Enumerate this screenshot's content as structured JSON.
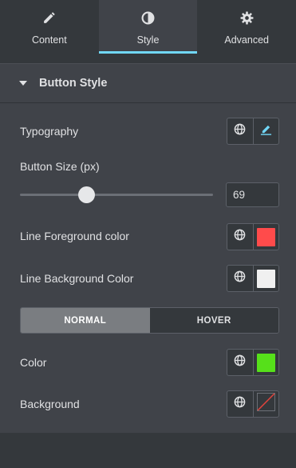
{
  "tabs": [
    {
      "label": "Content",
      "icon": "pencil-icon"
    },
    {
      "label": "Style",
      "icon": "half-circle-icon"
    },
    {
      "label": "Advanced",
      "icon": "gear-icon"
    }
  ],
  "active_tab": "Style",
  "section": {
    "title": "Button Style"
  },
  "controls": {
    "typography": {
      "label": "Typography"
    },
    "button_size": {
      "label": "Button Size (px)",
      "value": "69",
      "slider_fraction": 0.35
    },
    "line_foreground": {
      "label": "Line Foreground color",
      "color": "#ff4b4b"
    },
    "line_background": {
      "label": "Line Background Color",
      "color": "#f0f0f0"
    },
    "state_toggle": {
      "normal": "NORMAL",
      "hover": "HOVER",
      "active": "NORMAL"
    },
    "color": {
      "label": "Color",
      "color": "#56e01a"
    },
    "background": {
      "label": "Background",
      "color": "none"
    }
  },
  "colors": {
    "accent": "#71d7f7",
    "panel": "#404349",
    "dark": "#34383c"
  }
}
